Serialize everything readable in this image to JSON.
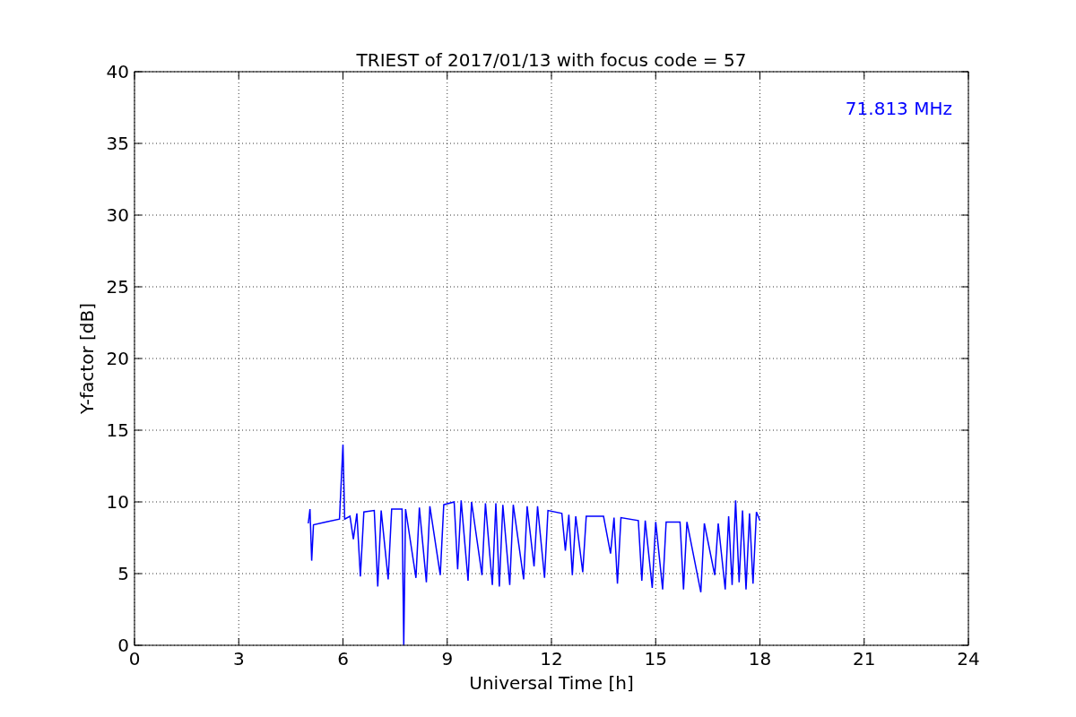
{
  "chart_data": {
    "type": "line",
    "title": "TRIEST of 2017/01/13 with focus code = 57",
    "xlabel": "Universal Time [h]",
    "ylabel": "Y-factor [dB]",
    "xlim": [
      0,
      24
    ],
    "ylim": [
      0,
      40
    ],
    "xticks": [
      0,
      3,
      6,
      9,
      12,
      15,
      18,
      21,
      24
    ],
    "yticks": [
      0,
      5,
      10,
      15,
      20,
      25,
      30,
      35,
      40
    ],
    "x": [
      5.0,
      5.05,
      5.1,
      5.15,
      5.5,
      5.9,
      6.0,
      6.05,
      6.2,
      6.3,
      6.4,
      6.5,
      6.6,
      6.9,
      7.0,
      7.1,
      7.3,
      7.4,
      7.7,
      7.75,
      7.8,
      8.1,
      8.2,
      8.4,
      8.5,
      8.8,
      8.9,
      9.2,
      9.3,
      9.4,
      9.6,
      9.7,
      10.0,
      10.1,
      10.3,
      10.4,
      10.5,
      10.6,
      10.8,
      10.9,
      11.2,
      11.3,
      11.5,
      11.6,
      11.8,
      11.9,
      12.3,
      12.4,
      12.5,
      12.6,
      12.7,
      12.9,
      13.0,
      13.5,
      13.7,
      13.8,
      13.9,
      14.0,
      14.5,
      14.6,
      14.7,
      14.9,
      15.0,
      15.2,
      15.3,
      15.7,
      15.8,
      15.9,
      16.3,
      16.4,
      16.7,
      16.8,
      17.0,
      17.1,
      17.2,
      17.3,
      17.4,
      17.5,
      17.6,
      17.7,
      17.8,
      17.9,
      18.0
    ],
    "series": [
      {
        "name": "71.813 MHz",
        "color": "#0000ff",
        "values": [
          8.5,
          9.5,
          5.9,
          8.4,
          8.6,
          8.8,
          14.0,
          8.8,
          9.0,
          7.4,
          9.2,
          4.8,
          9.3,
          9.4,
          4.1,
          9.4,
          4.6,
          9.5,
          9.5,
          0,
          9.5,
          4.7,
          9.6,
          4.4,
          9.7,
          4.9,
          9.8,
          10.0,
          5.3,
          10.1,
          4.5,
          10.0,
          4.9,
          9.9,
          4.2,
          9.9,
          4.1,
          9.8,
          4.2,
          9.8,
          4.6,
          9.7,
          5.5,
          9.7,
          4.7,
          9.4,
          9.2,
          6.6,
          9.1,
          4.9,
          9.0,
          5.1,
          9.0,
          9.0,
          6.4,
          8.9,
          4.3,
          8.9,
          8.7,
          4.5,
          8.7,
          4.0,
          8.6,
          3.9,
          8.6,
          8.6,
          3.9,
          8.6,
          3.7,
          8.5,
          4.9,
          8.5,
          3.9,
          9.0,
          4.2,
          10.1,
          4.4,
          9.4,
          3.9,
          9.2,
          4.3,
          9.3,
          8.7
        ]
      }
    ],
    "grid": true
  }
}
